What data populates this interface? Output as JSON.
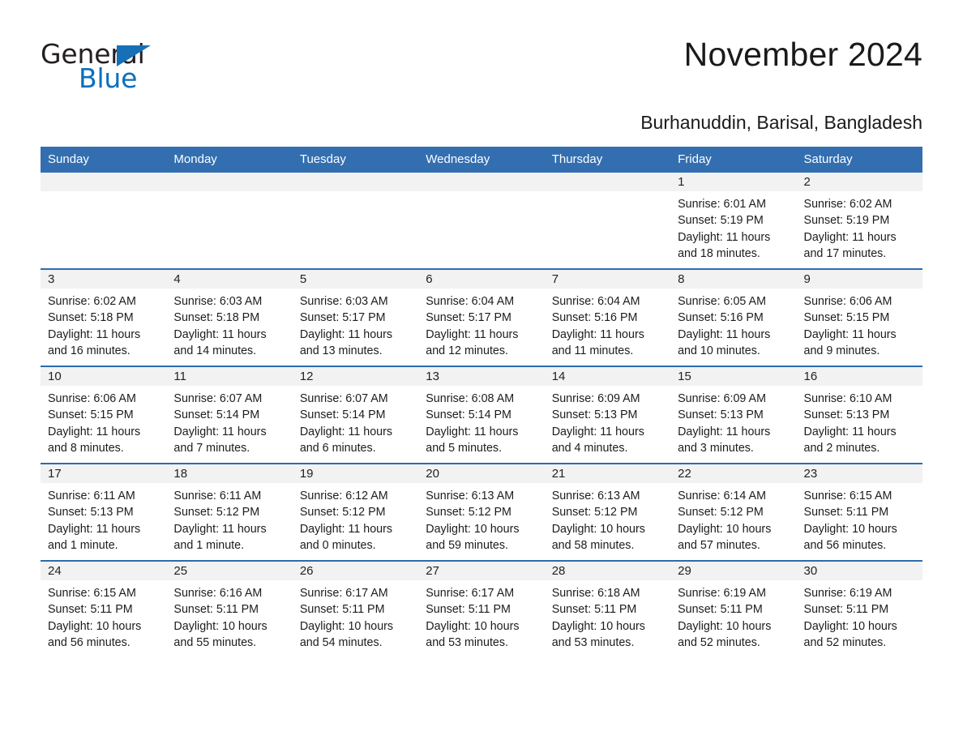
{
  "brand": {
    "name_part1": "General",
    "name_part2": "Blue",
    "triangle_color": "#1570b8",
    "blue_color": "#0a6fbd"
  },
  "header": {
    "month_title": "November 2024",
    "location": "Burhanuddin, Barisal, Bangladesh"
  },
  "theme": {
    "header_bg": "#336fb0",
    "row_border": "#2d6bad",
    "daynum_bg": "#f2f2f2"
  },
  "calendar": {
    "weekday_headers": [
      "Sunday",
      "Monday",
      "Tuesday",
      "Wednesday",
      "Thursday",
      "Friday",
      "Saturday"
    ],
    "weeks": [
      [
        {
          "day": "",
          "lines": []
        },
        {
          "day": "",
          "lines": []
        },
        {
          "day": "",
          "lines": []
        },
        {
          "day": "",
          "lines": []
        },
        {
          "day": "",
          "lines": []
        },
        {
          "day": "1",
          "lines": [
            "Sunrise: 6:01 AM",
            "Sunset: 5:19 PM",
            "Daylight: 11 hours",
            "and 18 minutes."
          ]
        },
        {
          "day": "2",
          "lines": [
            "Sunrise: 6:02 AM",
            "Sunset: 5:19 PM",
            "Daylight: 11 hours",
            "and 17 minutes."
          ]
        }
      ],
      [
        {
          "day": "3",
          "lines": [
            "Sunrise: 6:02 AM",
            "Sunset: 5:18 PM",
            "Daylight: 11 hours",
            "and 16 minutes."
          ]
        },
        {
          "day": "4",
          "lines": [
            "Sunrise: 6:03 AM",
            "Sunset: 5:18 PM",
            "Daylight: 11 hours",
            "and 14 minutes."
          ]
        },
        {
          "day": "5",
          "lines": [
            "Sunrise: 6:03 AM",
            "Sunset: 5:17 PM",
            "Daylight: 11 hours",
            "and 13 minutes."
          ]
        },
        {
          "day": "6",
          "lines": [
            "Sunrise: 6:04 AM",
            "Sunset: 5:17 PM",
            "Daylight: 11 hours",
            "and 12 minutes."
          ]
        },
        {
          "day": "7",
          "lines": [
            "Sunrise: 6:04 AM",
            "Sunset: 5:16 PM",
            "Daylight: 11 hours",
            "and 11 minutes."
          ]
        },
        {
          "day": "8",
          "lines": [
            "Sunrise: 6:05 AM",
            "Sunset: 5:16 PM",
            "Daylight: 11 hours",
            "and 10 minutes."
          ]
        },
        {
          "day": "9",
          "lines": [
            "Sunrise: 6:06 AM",
            "Sunset: 5:15 PM",
            "Daylight: 11 hours",
            "and 9 minutes."
          ]
        }
      ],
      [
        {
          "day": "10",
          "lines": [
            "Sunrise: 6:06 AM",
            "Sunset: 5:15 PM",
            "Daylight: 11 hours",
            "and 8 minutes."
          ]
        },
        {
          "day": "11",
          "lines": [
            "Sunrise: 6:07 AM",
            "Sunset: 5:14 PM",
            "Daylight: 11 hours",
            "and 7 minutes."
          ]
        },
        {
          "day": "12",
          "lines": [
            "Sunrise: 6:07 AM",
            "Sunset: 5:14 PM",
            "Daylight: 11 hours",
            "and 6 minutes."
          ]
        },
        {
          "day": "13",
          "lines": [
            "Sunrise: 6:08 AM",
            "Sunset: 5:14 PM",
            "Daylight: 11 hours",
            "and 5 minutes."
          ]
        },
        {
          "day": "14",
          "lines": [
            "Sunrise: 6:09 AM",
            "Sunset: 5:13 PM",
            "Daylight: 11 hours",
            "and 4 minutes."
          ]
        },
        {
          "day": "15",
          "lines": [
            "Sunrise: 6:09 AM",
            "Sunset: 5:13 PM",
            "Daylight: 11 hours",
            "and 3 minutes."
          ]
        },
        {
          "day": "16",
          "lines": [
            "Sunrise: 6:10 AM",
            "Sunset: 5:13 PM",
            "Daylight: 11 hours",
            "and 2 minutes."
          ]
        }
      ],
      [
        {
          "day": "17",
          "lines": [
            "Sunrise: 6:11 AM",
            "Sunset: 5:13 PM",
            "Daylight: 11 hours",
            "and 1 minute."
          ]
        },
        {
          "day": "18",
          "lines": [
            "Sunrise: 6:11 AM",
            "Sunset: 5:12 PM",
            "Daylight: 11 hours",
            "and 1 minute."
          ]
        },
        {
          "day": "19",
          "lines": [
            "Sunrise: 6:12 AM",
            "Sunset: 5:12 PM",
            "Daylight: 11 hours",
            "and 0 minutes."
          ]
        },
        {
          "day": "20",
          "lines": [
            "Sunrise: 6:13 AM",
            "Sunset: 5:12 PM",
            "Daylight: 10 hours",
            "and 59 minutes."
          ]
        },
        {
          "day": "21",
          "lines": [
            "Sunrise: 6:13 AM",
            "Sunset: 5:12 PM",
            "Daylight: 10 hours",
            "and 58 minutes."
          ]
        },
        {
          "day": "22",
          "lines": [
            "Sunrise: 6:14 AM",
            "Sunset: 5:12 PM",
            "Daylight: 10 hours",
            "and 57 minutes."
          ]
        },
        {
          "day": "23",
          "lines": [
            "Sunrise: 6:15 AM",
            "Sunset: 5:11 PM",
            "Daylight: 10 hours",
            "and 56 minutes."
          ]
        }
      ],
      [
        {
          "day": "24",
          "lines": [
            "Sunrise: 6:15 AM",
            "Sunset: 5:11 PM",
            "Daylight: 10 hours",
            "and 56 minutes."
          ]
        },
        {
          "day": "25",
          "lines": [
            "Sunrise: 6:16 AM",
            "Sunset: 5:11 PM",
            "Daylight: 10 hours",
            "and 55 minutes."
          ]
        },
        {
          "day": "26",
          "lines": [
            "Sunrise: 6:17 AM",
            "Sunset: 5:11 PM",
            "Daylight: 10 hours",
            "and 54 minutes."
          ]
        },
        {
          "day": "27",
          "lines": [
            "Sunrise: 6:17 AM",
            "Sunset: 5:11 PM",
            "Daylight: 10 hours",
            "and 53 minutes."
          ]
        },
        {
          "day": "28",
          "lines": [
            "Sunrise: 6:18 AM",
            "Sunset: 5:11 PM",
            "Daylight: 10 hours",
            "and 53 minutes."
          ]
        },
        {
          "day": "29",
          "lines": [
            "Sunrise: 6:19 AM",
            "Sunset: 5:11 PM",
            "Daylight: 10 hours",
            "and 52 minutes."
          ]
        },
        {
          "day": "30",
          "lines": [
            "Sunrise: 6:19 AM",
            "Sunset: 5:11 PM",
            "Daylight: 10 hours",
            "and 52 minutes."
          ]
        }
      ]
    ]
  }
}
